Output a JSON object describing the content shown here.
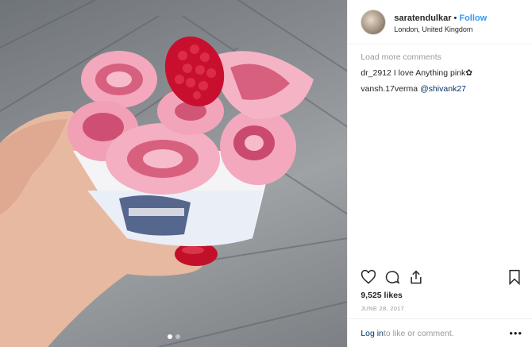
{
  "post": {
    "username": "saratendulkar",
    "separator": "•",
    "follow_label": "Follow",
    "location": "London, United Kingdom",
    "load_more": "Load more comments",
    "comments": [
      {
        "user": "dr_2912",
        "text": "I love Anything pink✿"
      },
      {
        "user": "vansh.17verma",
        "mention": "@shivank27"
      }
    ],
    "likes": "9,525 likes",
    "date": "JUNE 28, 2017",
    "footer": {
      "login": "Log in",
      "rest": " to like or comment."
    },
    "more_icon": "•••",
    "icons": [
      "heart-icon",
      "comment-icon",
      "share-icon",
      "bookmark-icon"
    ]
  }
}
